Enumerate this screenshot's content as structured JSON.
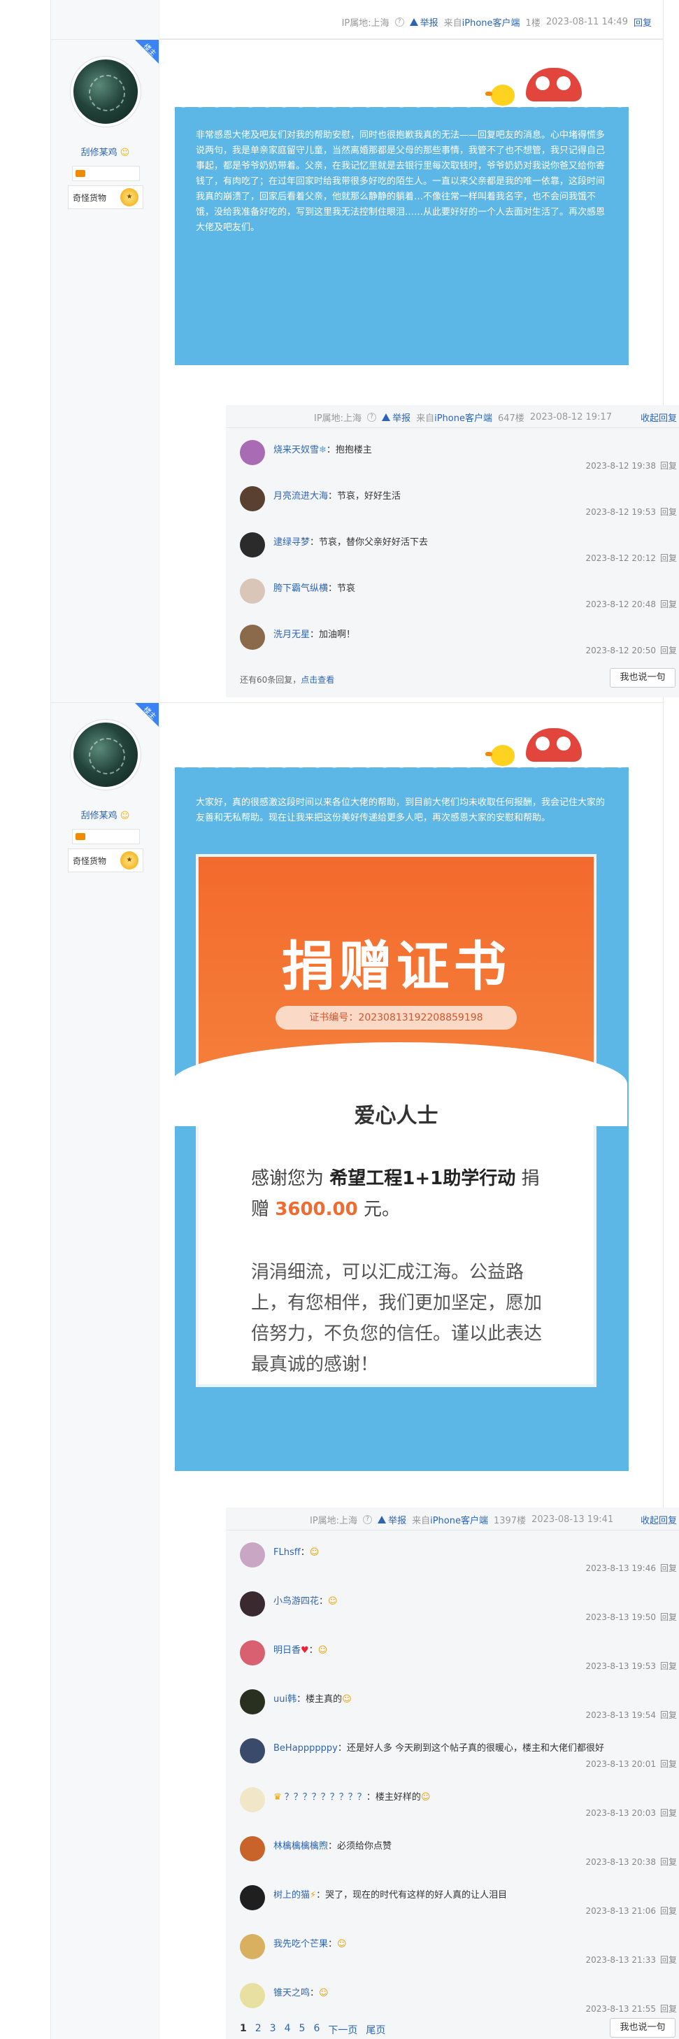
{
  "top_meta": {
    "ip": "IP属地:上海",
    "report": "举报",
    "source_prefix": "来自",
    "source": "iPhone客户端",
    "floor": "1楼",
    "time": "2023-08-11 14:49",
    "reply": "回复"
  },
  "post1": {
    "corner": "楼主",
    "username": "刮修某鸡",
    "level": "",
    "badge_label": "奇怪货物",
    "text": "非常感恩大佬及吧友们对我的帮助安慰，同时也很抱歉我真的无法——回复吧友的消息。心中堵得慌多说两句，我是单亲家庭留守儿童，当然离婚那都是父母的那些事情，我管不了也不想管，我只记得自己事起，都是爷爷奶奶带着。父亲，在我记忆里就是去银行里每次取钱时，爷爷奶奶对我说你爸又给你寄钱了，有肉吃了；在过年回家时给我带很多好吃的陌生人。一直以来父亲都是我的唯一依靠，这段时间我真的崩溃了，回家后看着父亲，他就那么静静的躺着…不像往常一样叫着我名字，也不会问我饿不饿，没给我准备好吃的，写到这里我无法控制住眼泪……从此要好好的一个人去面对生活了。再次感恩大佬及吧友们。",
    "meta": {
      "ip": "IP属地:上海",
      "report": "举报",
      "source_prefix": "来自",
      "source": "iPhone客户端",
      "floor": "647楼",
      "time": "2023-08-12 19:17",
      "collapse": "收起回复"
    },
    "comments": [
      {
        "name": "烧来天奴雪",
        "text": "：抱抱楼主",
        "time": "2023-8-12 19:38",
        "reply": "回复"
      },
      {
        "name": "月亮流进大海",
        "text": "：节哀，好好生活",
        "time": "2023-8-12 19:53",
        "reply": "回复"
      },
      {
        "name": "逮绿寻梦",
        "text": "：节哀，替你父亲好好活下去",
        "time": "2023-8-12 20:12",
        "reply": "回复"
      },
      {
        "name": "胯下霸气纵横",
        "text": "：节哀",
        "time": "2023-8-12 20:48",
        "reply": "回复"
      },
      {
        "name": "洗月无星",
        "text": "：加油啊！",
        "time": "2023-8-12 20:50",
        "reply": "回复"
      }
    ],
    "more": "还有60条回复，",
    "more_link": "点击查看",
    "say": "我也说一句"
  },
  "post2": {
    "corner": "楼主",
    "username": "刮修某鸡",
    "level": "",
    "badge_label": "奇怪货物",
    "text": "大家好，真的很感激这段时间以来各位大佬的帮助，到目前大佬们均未收取任何报酬，我会记住大家的友善和无私帮助。现在让我来把这份美好传递给更多人吧，再次感恩大家的安慰和帮助。",
    "cert": {
      "title": "捐赠证书",
      "number": "证书编号：20230813192208859198",
      "who": "爱心人士",
      "p1a": "感谢您为 ",
      "p1b": "希望工程1+1助学行动",
      "p1c": " 捐赠 ",
      "amount": "3600.00",
      "p1d": " 元。",
      "p2": "涓涓细流，可以汇成江海。公益路上，有您相伴，我们更加坚定，愿加倍努力，不负您的信任。谨以此表达最真诚的感谢！"
    },
    "meta": {
      "ip": "IP属地:上海",
      "report": "举报",
      "source_prefix": "来自",
      "source": "iPhone客户端",
      "floor": "1397楼",
      "time": "2023-08-13 19:41",
      "collapse": "收起回复"
    },
    "comments": [
      {
        "name": "FLhsff",
        "text": "：",
        "time": "2023-8-13 19:46",
        "reply": "回复"
      },
      {
        "name": "小鸟游四花",
        "text": "：",
        "time": "2023-8-13 19:50",
        "reply": "回复"
      },
      {
        "name": "明日香",
        "text": "：",
        "time": "2023-8-13 19:53",
        "reply": "回复"
      },
      {
        "name": "uui韩",
        "text": "：楼主真的",
        "time": "2023-8-13 19:54",
        "reply": "回复"
      },
      {
        "name": "BeHappppppy",
        "text": "：还是好人多 今天刷到这个帖子真的很暖心，楼主和大佬们都很好",
        "time": "2023-8-13 20:01",
        "reply": "回复"
      },
      {
        "name": "？？？？？？？？？",
        "text": "：楼主好样的",
        "time": "2023-8-13 20:03",
        "reply": "回复"
      },
      {
        "name": "林檎檎檎檎煦",
        "text": "：必须给你点赞",
        "time": "2023-8-13 20:38",
        "reply": "回复"
      },
      {
        "name": "树上的猫",
        "text": "：哭了，现在的时代有这样的好人真的让人泪目",
        "time": "2023-8-13 21:06",
        "reply": "回复"
      },
      {
        "name": "我先吃个芒果",
        "text": "：",
        "time": "2023-8-13 21:33",
        "reply": "回复"
      },
      {
        "name": "锥天之鸣",
        "text": "：",
        "time": "2023-8-13 21:55",
        "reply": "回复"
      }
    ],
    "pager": [
      "1",
      "2",
      "3",
      "4",
      "5",
      "6",
      "下一页",
      "尾页"
    ],
    "say": "我也说一句"
  }
}
